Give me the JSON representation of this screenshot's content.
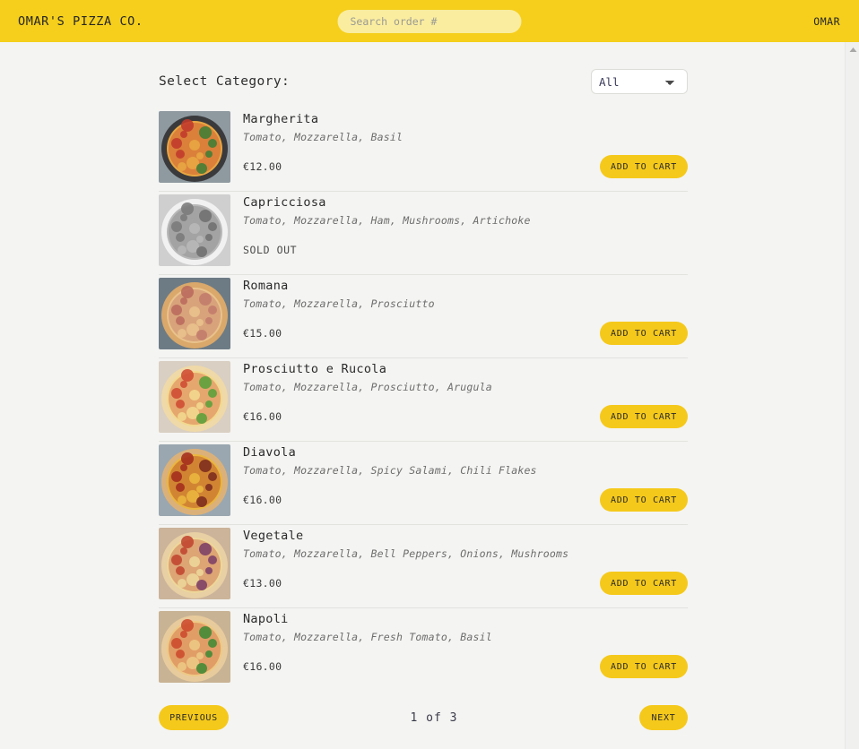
{
  "header": {
    "brand": "OMAR'S PIZZA CO.",
    "search_placeholder": "Search order #",
    "search_value": "",
    "user": "OMAR",
    "bg_color": "#f5cf1c"
  },
  "filter": {
    "label": "Select Category:",
    "selected": "All",
    "options": [
      "All"
    ]
  },
  "labels": {
    "add_to_cart": "ADD TO CART",
    "sold_out": "SOLD OUT"
  },
  "items": [
    {
      "name": "Margherita",
      "ingredients": "Tomato, Mozzarella, Basil",
      "price": "€12.00",
      "available": true,
      "image": "margherita-pan-pizza-thumbnail"
    },
    {
      "name": "Capricciosa",
      "ingredients": "Tomato, Mozzarella, Ham, Mushrooms, Artichoke",
      "price": "",
      "available": false,
      "image": "capricciosa-pizza-thumbnail-grayscale"
    },
    {
      "name": "Romana",
      "ingredients": "Tomato, Mozzarella, Prosciutto",
      "price": "€15.00",
      "available": true,
      "image": "romana-pizza-thumbnail"
    },
    {
      "name": "Prosciutto e Rucola",
      "ingredients": "Tomato, Mozzarella, Prosciutto, Arugula",
      "price": "€16.00",
      "available": true,
      "image": "prosciutto-e-rucola-pizza-thumbnail"
    },
    {
      "name": "Diavola",
      "ingredients": "Tomato, Mozzarella, Spicy Salami, Chili Flakes",
      "price": "€16.00",
      "available": true,
      "image": "diavola-pizza-thumbnail"
    },
    {
      "name": "Vegetale",
      "ingredients": "Tomato, Mozzarella, Bell Peppers, Onions, Mushrooms",
      "price": "€13.00",
      "available": true,
      "image": "vegetale-pizza-thumbnail"
    },
    {
      "name": "Napoli",
      "ingredients": "Tomato, Mozzarella, Fresh Tomato, Basil",
      "price": "€16.00",
      "available": true,
      "image": "napoli-pizza-thumbnail"
    }
  ],
  "pagination": {
    "previous": "PREVIOUS",
    "next": "NEXT",
    "indicator": "1 of 3",
    "current_page": 1,
    "total_pages": 3
  },
  "colors": {
    "brand_yellow": "#f5cf1c",
    "button_yellow": "#f5c91b",
    "search_yellow": "#faeda0",
    "page_background": "#f4f4f2",
    "divider": "#e2e2df"
  }
}
